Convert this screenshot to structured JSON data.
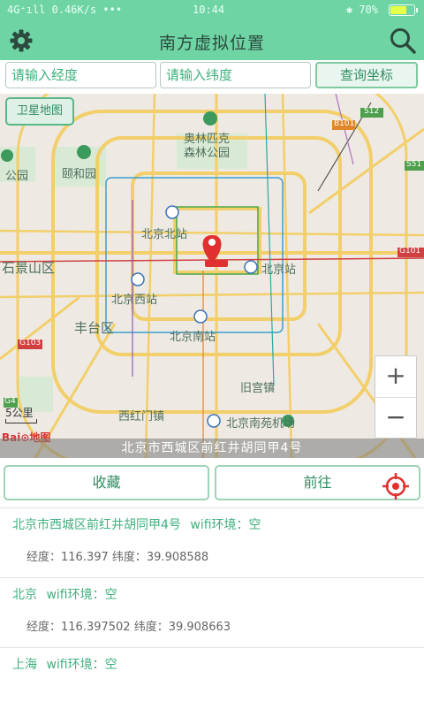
{
  "status": {
    "signal": "4G⁺ıll",
    "speed": "0.46K/s",
    "dots": "•••",
    "time": "10:44",
    "bluetooth": "✱",
    "battery_percent": "70%",
    "battery_level": 0.7
  },
  "header": {
    "title": "南方虚拟位置",
    "settings_icon": "gear-icon",
    "search_icon": "search-icon"
  },
  "query": {
    "longitude_placeholder": "请输入经度",
    "latitude_placeholder": "请输入纬度",
    "button_label": "查询坐标"
  },
  "map": {
    "satellite_button": "卫星地图",
    "labels": {
      "l1": "B101",
      "l2": "S12",
      "l3": "S51",
      "l4": "G101",
      "l5": "G103",
      "l6": "G4",
      "l7": "奥林匹克",
      "l8": "森林公园",
      "l9": "颐和园",
      "l10": "公园",
      "l11": "北京北站",
      "l12": "石景山区",
      "l13": "北京站",
      "l14": "北京西站",
      "l15": "丰台区",
      "l16": "北京南站",
      "l17": "旧宫镇",
      "l18": "西红门镇",
      "l19": "北京南苑机场"
    },
    "zoom_in": "+",
    "zoom_out": "−",
    "scale_label": "5公里",
    "logo_text": "Bai⊙地图",
    "address_strip": "北京市西城区前红井胡同甲4号"
  },
  "actions": {
    "favorite": "收藏",
    "goto": "前往"
  },
  "history": [
    {
      "title": "北京市西城区前红井胡同甲4号",
      "wifi": "wifi环境：空",
      "coords": "经度：116.397    纬度：39.908588"
    },
    {
      "title": "北京",
      "wifi": "wifi环境：空",
      "coords": "经度：116.397502    纬度：39.908663"
    },
    {
      "title": "上海",
      "wifi": "wifi环境：空",
      "coords": ""
    }
  ],
  "colors": {
    "accent": "#6ed4a4",
    "text_green": "#3fb07e",
    "marker": "#e03030"
  }
}
